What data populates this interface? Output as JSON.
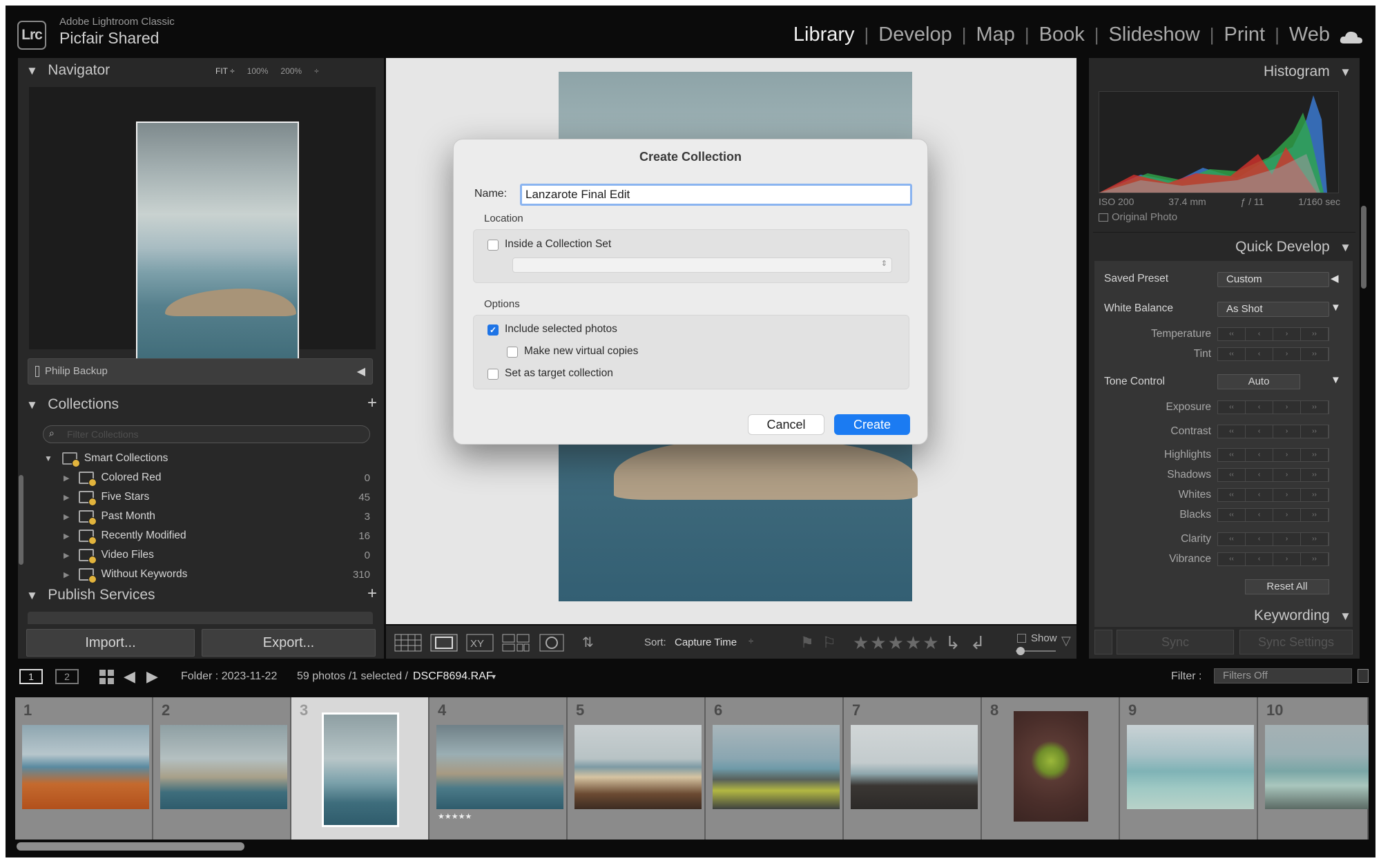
{
  "app": {
    "name": "Adobe Lightroom Classic",
    "catalog": "Picfair Shared",
    "logo": "Lrc"
  },
  "modules": [
    "Library",
    "Develop",
    "Map",
    "Book",
    "Slideshow",
    "Print",
    "Web"
  ],
  "active_module": "Library",
  "navigator": {
    "title": "Navigator",
    "zoom_options": [
      "FIT ÷",
      "100%",
      "200%",
      "÷"
    ]
  },
  "folder_panel": {
    "label": "Philip Backup"
  },
  "collections": {
    "title": "Collections",
    "filter_placeholder": "Filter Collections",
    "smart_group": "Smart Collections",
    "items": [
      {
        "label": "Colored Red",
        "count": "0"
      },
      {
        "label": "Five Stars",
        "count": "45"
      },
      {
        "label": "Past Month",
        "count": "3"
      },
      {
        "label": "Recently Modified",
        "count": "16"
      },
      {
        "label": "Video Files",
        "count": "0"
      },
      {
        "label": "Without Keywords",
        "count": "310"
      }
    ]
  },
  "publish": {
    "title": "Publish Services"
  },
  "buttons": {
    "import": "Import...",
    "export": "Export..."
  },
  "dialog": {
    "title": "Create Collection",
    "name_label": "Name:",
    "name_value": "Lanzarote Final Edit",
    "location_label": "Location",
    "inside_set": "Inside a Collection Set",
    "options_label": "Options",
    "include_selected": "Include selected photos",
    "virtual_copies": "Make new virtual copies",
    "target_collection": "Set as target collection",
    "cancel": "Cancel",
    "create": "Create"
  },
  "toolbar": {
    "sort_label": "Sort:",
    "sort_value": "Capture Time",
    "show_label": "Show"
  },
  "histogram": {
    "title": "Histogram",
    "iso": "ISO 200",
    "focal": "37.4 mm",
    "aperture": "ƒ / 11",
    "shutter": "1/160 sec",
    "original_photo": "Original Photo"
  },
  "quick_develop": {
    "title": "Quick Develop",
    "saved_preset_label": "Saved Preset",
    "saved_preset_value": "Custom",
    "white_balance_label": "White Balance",
    "white_balance_value": "As Shot",
    "temperature": "Temperature",
    "tint": "Tint",
    "tone_control": "Tone Control",
    "auto": "Auto",
    "exposure": "Exposure",
    "contrast": "Contrast",
    "highlights": "Highlights",
    "shadows": "Shadows",
    "whites": "Whites",
    "blacks": "Blacks",
    "clarity": "Clarity",
    "vibrance": "Vibrance",
    "reset_all": "Reset All"
  },
  "keywording": {
    "title": "Keywording"
  },
  "sync": {
    "sync": "Sync",
    "sync_settings": "Sync Settings"
  },
  "filmstrip_bar": {
    "view1": "1",
    "view2": "2",
    "folder": "Folder : 2023-11-22",
    "selection": "59 photos /1 selected /",
    "filename": "DSCF8694.RAF",
    "filter_label": "Filter :",
    "filter_value": "Filters Off"
  },
  "filmstrip": {
    "numbers": [
      "1",
      "2",
      "3",
      "4",
      "5",
      "6",
      "7",
      "8",
      "9",
      "10"
    ],
    "stars": "★★★★★"
  }
}
